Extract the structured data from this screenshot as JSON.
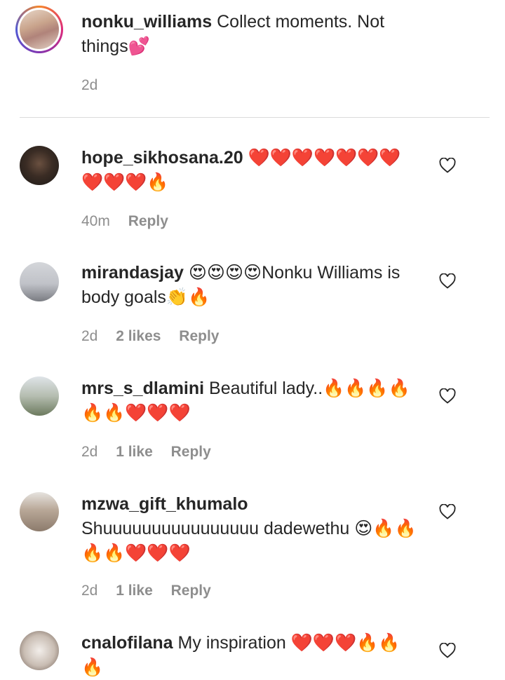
{
  "caption": {
    "username": "nonku_williams",
    "text": "Collect moments. Not things💕",
    "time": "2d"
  },
  "comments": [
    {
      "username": "hope_sikhosana.20",
      "text": "❤️❤️❤️❤️❤️❤️❤️❤️❤️❤️🔥",
      "time": "40m",
      "likes": "",
      "reply": "Reply"
    },
    {
      "username": "mirandasjay",
      "text": "😍😍😍😍Nonku Williams is body goals👏🔥",
      "time": "2d",
      "likes": "2 likes",
      "reply": "Reply"
    },
    {
      "username": "mrs_s_dlamini",
      "text": "Beautiful lady..🔥🔥🔥🔥🔥🔥❤️❤️❤️",
      "time": "2d",
      "likes": "1 like",
      "reply": "Reply"
    },
    {
      "username": "mzwa_gift_khumalo",
      "text": "Shuuuuuuuuuuuuuuuu dadewethu 😍🔥🔥🔥🔥❤️❤️❤️",
      "time": "2d",
      "likes": "1 like",
      "reply": "Reply"
    },
    {
      "username": "cnalofilana",
      "text": "My inspiration ❤️❤️❤️🔥🔥🔥",
      "time": "",
      "likes": "",
      "reply": ""
    }
  ],
  "icons": {
    "like": "heart-outline-icon"
  },
  "colors": {
    "text": "#262626",
    "meta": "#8e8e8e",
    "divider": "#dbdbdb"
  }
}
